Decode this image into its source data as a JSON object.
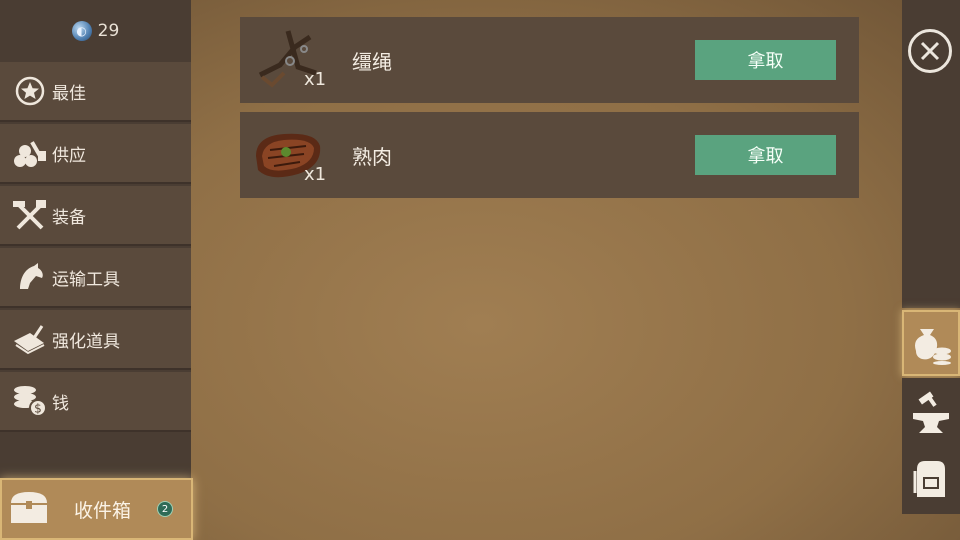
{
  "currency": {
    "icon": "gem-icon",
    "amount": "29"
  },
  "categories": [
    {
      "label": "最佳",
      "icon": "star-icon"
    },
    {
      "label": "供应",
      "icon": "logs-icon"
    },
    {
      "label": "装备",
      "icon": "crossed-tools-icon"
    },
    {
      "label": "运输工具",
      "icon": "horse-head-icon"
    },
    {
      "label": "强化道具",
      "icon": "book-quill-icon"
    },
    {
      "label": "钱",
      "icon": "coins-icon"
    }
  ],
  "inbox": {
    "label": "收件箱",
    "badge": "2",
    "icon": "chest-icon"
  },
  "items": [
    {
      "name": "缰绳",
      "qty": "x1",
      "icon": "reins-icon",
      "button": "拿取"
    },
    {
      "name": "熟肉",
      "qty": "x1",
      "icon": "cooked-meat-icon",
      "button": "拿取"
    }
  ],
  "right_tabs": [
    {
      "icon": "money-bag-icon",
      "active": true
    },
    {
      "icon": "anvil-icon",
      "active": false
    },
    {
      "icon": "backpack-icon",
      "active": false
    }
  ],
  "colors": {
    "accent_green": "#5aa37f",
    "panel": "#5a4a3c",
    "sidebar": "#4a3d33",
    "highlight": "#b08a58"
  }
}
